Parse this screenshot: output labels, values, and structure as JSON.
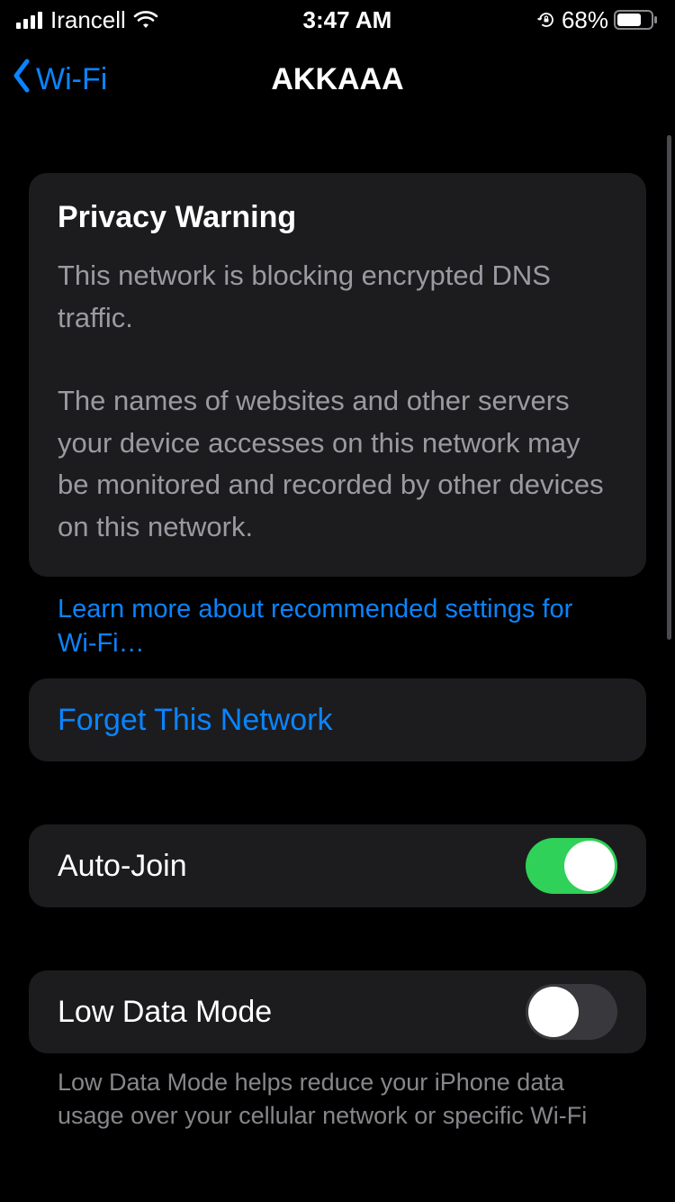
{
  "status": {
    "carrier": "Irancell",
    "time": "3:47 AM",
    "battery_pct": "68%"
  },
  "nav": {
    "back_label": "Wi-Fi",
    "title": "AKKAAA"
  },
  "warning": {
    "title": "Privacy Warning",
    "line1": "This network is blocking encrypted DNS traffic.",
    "line2": "The names of websites and other servers your device accesses on this network may be monitored and recorded by other devices on this network."
  },
  "learn_more": "Learn more about recommended settings for Wi‑Fi…",
  "forget_label": "Forget This Network",
  "auto_join": {
    "label": "Auto-Join",
    "on": true
  },
  "low_data": {
    "label": "Low Data Mode",
    "on": false,
    "footer": "Low Data Mode helps reduce your iPhone data usage over your cellular network or specific Wi-Fi"
  },
  "colors": {
    "accent": "#0a84ff",
    "toggle_on": "#30d158",
    "card_bg": "#1c1c1e"
  }
}
